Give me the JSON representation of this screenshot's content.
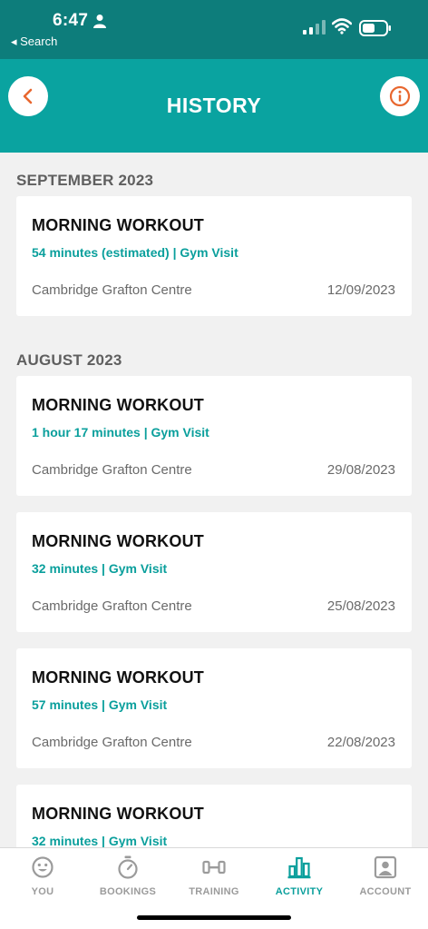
{
  "status_bar": {
    "time": "6:47",
    "back_label": "◂ Search"
  },
  "header": {
    "title": "HISTORY"
  },
  "sections": [
    {
      "title": "SEPTEMBER 2023",
      "items": [
        {
          "title": "MORNING WORKOUT",
          "meta": "54 minutes (estimated)  |  Gym Visit",
          "place": "Cambridge Grafton Centre",
          "date": "12/09/2023"
        }
      ]
    },
    {
      "title": "AUGUST 2023",
      "items": [
        {
          "title": "MORNING WORKOUT",
          "meta": "1 hour 17 minutes  |  Gym Visit",
          "place": "Cambridge Grafton Centre",
          "date": "29/08/2023"
        },
        {
          "title": "MORNING WORKOUT",
          "meta": "32 minutes  |  Gym Visit",
          "place": "Cambridge Grafton Centre",
          "date": "25/08/2023"
        },
        {
          "title": "MORNING WORKOUT",
          "meta": "57 minutes  |  Gym Visit",
          "place": "Cambridge Grafton Centre",
          "date": "22/08/2023"
        },
        {
          "title": "MORNING WORKOUT",
          "meta": "32 minutes  |  Gym Visit",
          "place": "",
          "date": ""
        }
      ]
    }
  ],
  "tabs": [
    {
      "label": "YOU",
      "icon": "smiley-icon",
      "active": false
    },
    {
      "label": "BOOKINGS",
      "icon": "stopwatch-icon",
      "active": false
    },
    {
      "label": "TRAINING",
      "icon": "dumbbell-icon",
      "active": false
    },
    {
      "label": "ACTIVITY",
      "icon": "bar-chart-icon",
      "active": true
    },
    {
      "label": "ACCOUNT",
      "icon": "profile-card-icon",
      "active": false
    }
  ],
  "colors": {
    "status_bar": "#0d7d7b",
    "header": "#0aa3a0",
    "accent": "#0a9f9c",
    "icon_orange": "#e8672f"
  }
}
